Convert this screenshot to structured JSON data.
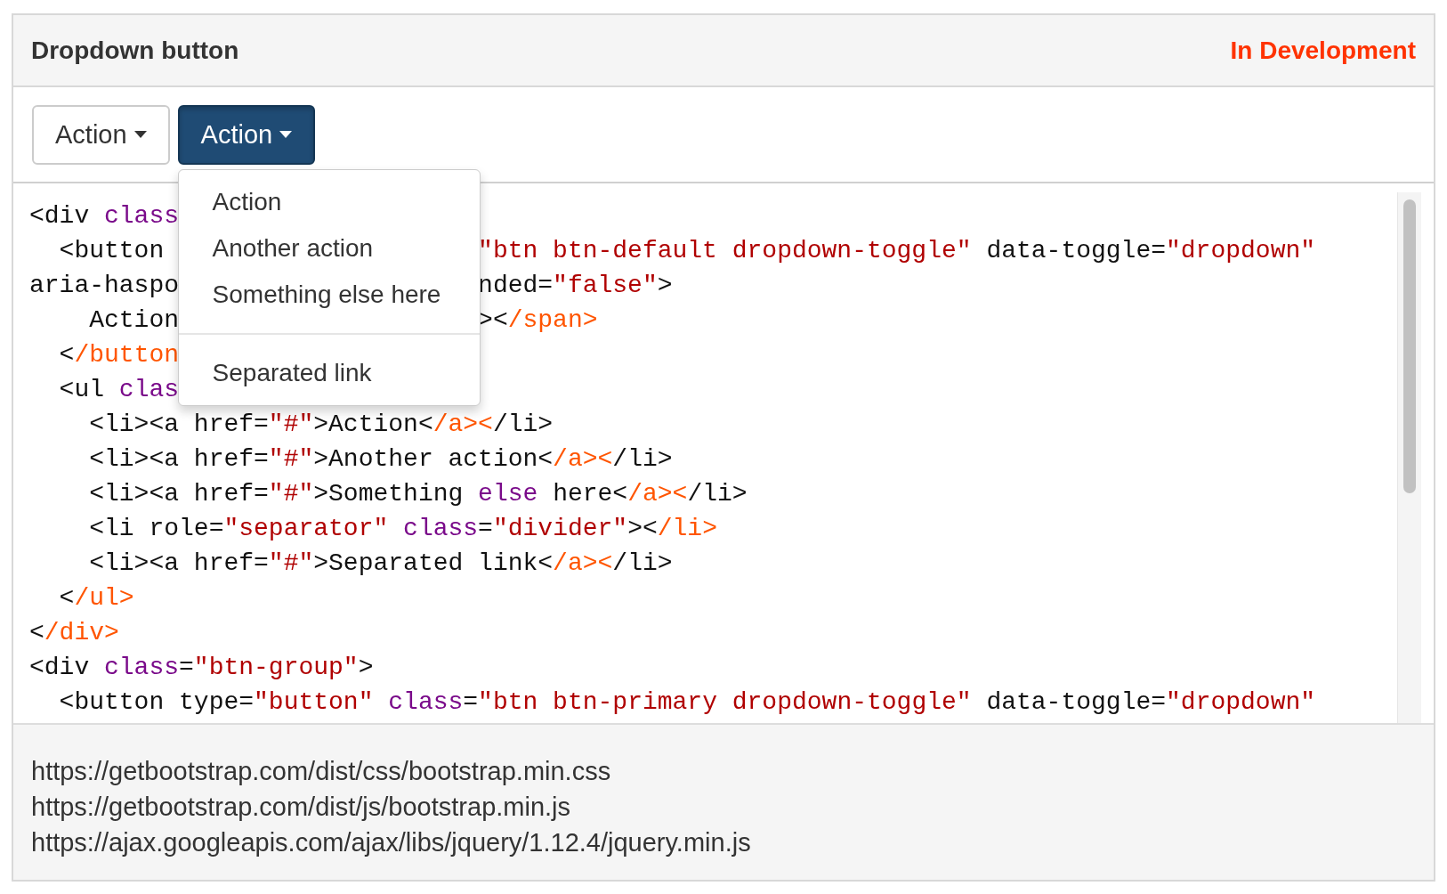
{
  "header": {
    "title": "Dropdown button",
    "status": "In Development"
  },
  "buttons": [
    {
      "label": "Action",
      "kind": "default",
      "open": false
    },
    {
      "label": "Action",
      "kind": "primary",
      "open": true
    }
  ],
  "menu": [
    {
      "kind": "item",
      "label": "Action"
    },
    {
      "kind": "item",
      "label": "Another action"
    },
    {
      "kind": "item",
      "label": "Something else here"
    },
    {
      "kind": "divider"
    },
    {
      "kind": "item",
      "label": "Separated link"
    }
  ],
  "code_lines": [
    {
      "left": [
        {
          "kind": "plain",
          "s": "<div "
        },
        {
          "kind": "attr",
          "s": "class"
        }
      ]
    },
    {
      "left": [
        {
          "kind": "plain",
          "s": "  <button"
        }
      ],
      "right": [
        {
          "kind": "string",
          "s": "\"btn btn-default dropdown-toggle\""
        },
        {
          "kind": "plain",
          "s": " data-toggle="
        },
        {
          "kind": "string",
          "s": "\"dropdown\""
        }
      ]
    },
    {
      "left": [
        {
          "kind": "plain",
          "s": "aria-haspo"
        }
      ],
      "right": [
        {
          "kind": "plain",
          "s": "nded="
        },
        {
          "kind": "string",
          "s": "\"false\""
        },
        {
          "kind": "plain",
          "s": ">"
        }
      ]
    },
    {
      "left": [
        {
          "kind": "plain",
          "s": "    Action"
        }
      ],
      "right": [
        {
          "kind": "plain",
          "s": "><"
        },
        {
          "kind": "tag",
          "s": "/span>"
        }
      ]
    },
    {
      "left": [
        {
          "kind": "plain",
          "s": "  <"
        },
        {
          "kind": "tag",
          "s": "/button"
        }
      ]
    },
    {
      "left": [
        {
          "kind": "plain",
          "s": "  <ul "
        },
        {
          "kind": "attr",
          "s": "clas"
        }
      ]
    },
    {
      "left": [
        {
          "kind": "plain",
          "s": "    <li><a href="
        },
        {
          "kind": "string",
          "s": "\"#\""
        },
        {
          "kind": "plain",
          "s": ">Action<"
        },
        {
          "kind": "tag",
          "s": "/a><"
        },
        {
          "kind": "plain",
          "s": "/li>"
        }
      ]
    },
    {
      "left": [
        {
          "kind": "plain",
          "s": "    <li><a href="
        },
        {
          "kind": "string",
          "s": "\"#\""
        },
        {
          "kind": "plain",
          "s": ">Another action<"
        },
        {
          "kind": "tag",
          "s": "/a><"
        },
        {
          "kind": "plain",
          "s": "/li>"
        }
      ]
    },
    {
      "left": [
        {
          "kind": "plain",
          "s": "    <li><a href="
        },
        {
          "kind": "string",
          "s": "\"#\""
        },
        {
          "kind": "plain",
          "s": ">Something "
        },
        {
          "kind": "attr",
          "s": "else"
        },
        {
          "kind": "plain",
          "s": " here<"
        },
        {
          "kind": "tag",
          "s": "/a><"
        },
        {
          "kind": "plain",
          "s": "/li>"
        }
      ]
    },
    {
      "left": [
        {
          "kind": "plain",
          "s": "    <li role="
        },
        {
          "kind": "string",
          "s": "\"separator\""
        },
        {
          "kind": "attr",
          "s": " class"
        },
        {
          "kind": "plain",
          "s": "="
        },
        {
          "kind": "string",
          "s": "\"divider\""
        },
        {
          "kind": "plain",
          "s": "><"
        },
        {
          "kind": "tag",
          "s": "/li>"
        }
      ]
    },
    {
      "left": [
        {
          "kind": "plain",
          "s": "    <li><a href="
        },
        {
          "kind": "string",
          "s": "\"#\""
        },
        {
          "kind": "plain",
          "s": ">Separated link<"
        },
        {
          "kind": "tag",
          "s": "/a><"
        },
        {
          "kind": "plain",
          "s": "/li>"
        }
      ]
    },
    {
      "left": [
        {
          "kind": "plain",
          "s": "  <"
        },
        {
          "kind": "tag",
          "s": "/ul>"
        }
      ]
    },
    {
      "left": [
        {
          "kind": "plain",
          "s": "<"
        },
        {
          "kind": "tag",
          "s": "/div>"
        }
      ]
    },
    {
      "left": [
        {
          "kind": "plain",
          "s": "<div "
        },
        {
          "kind": "attr",
          "s": "class"
        },
        {
          "kind": "plain",
          "s": "="
        },
        {
          "kind": "string",
          "s": "\"btn-group\""
        },
        {
          "kind": "plain",
          "s": ">"
        }
      ]
    },
    {
      "left": [
        {
          "kind": "plain",
          "s": "  <button type="
        },
        {
          "kind": "string",
          "s": "\"button\""
        },
        {
          "kind": "attr",
          "s": " class"
        },
        {
          "kind": "plain",
          "s": "="
        },
        {
          "kind": "string",
          "s": "\"btn btn-primary dropdown-toggle\""
        },
        {
          "kind": "plain",
          "s": " data-toggle="
        },
        {
          "kind": "string",
          "s": "\"dropdown\""
        }
      ]
    }
  ],
  "resources": [
    "https://getbootstrap.com/dist/css/bootstrap.min.css",
    "https://getbootstrap.com/dist/js/bootstrap.min.js",
    "https://ajax.googleapis.com/ajax/libs/jquery/1.12.4/jquery.min.js"
  ]
}
